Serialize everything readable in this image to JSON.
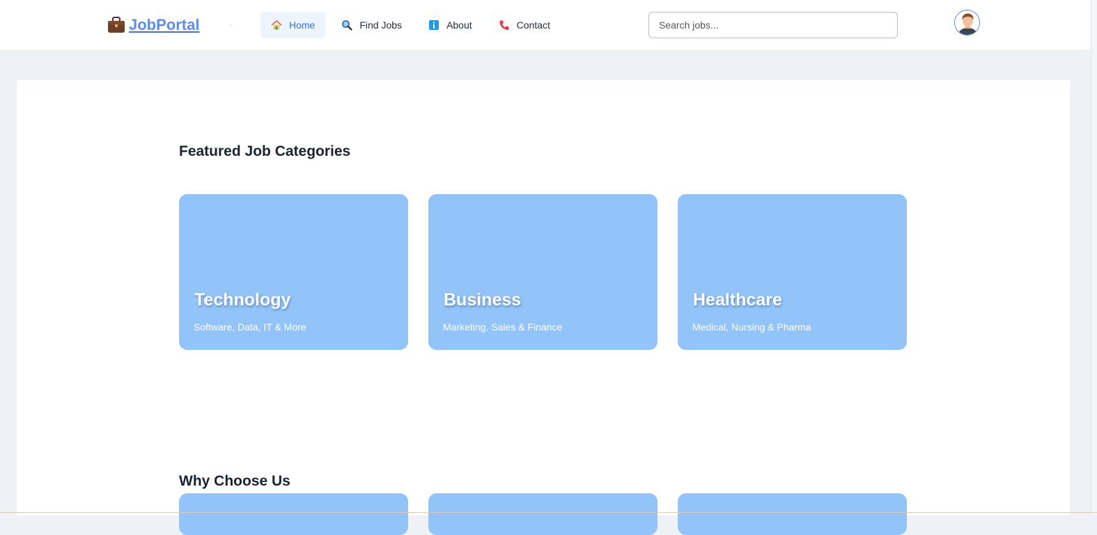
{
  "header": {
    "logo_text": "JobPortal",
    "logo_icon": "briefcase-icon",
    "nav": [
      {
        "label": "Home",
        "icon": "home-icon",
        "active": true
      },
      {
        "label": "Find Jobs",
        "icon": "magnifier-icon",
        "active": false
      },
      {
        "label": "About",
        "icon": "info-icon",
        "active": false
      },
      {
        "label": "Contact",
        "icon": "phone-icon",
        "active": false
      }
    ],
    "search": {
      "placeholder": "Search jobs...",
      "value": ""
    },
    "avatar_icon": "user-avatar-icon"
  },
  "featured": {
    "title": "Featured Job Categories",
    "cards": [
      {
        "title": "Technology",
        "subtitle": "Software, Data, IT & More"
      },
      {
        "title": "Business",
        "subtitle": "Marketing, Sales & Finance"
      },
      {
        "title": "Healthcare",
        "subtitle": "Medical, Nursing & Pharma"
      }
    ]
  },
  "why": {
    "title": "Why Choose Us"
  },
  "colors": {
    "accent": "#3b6fd0",
    "card": "#92c3f9",
    "page_bg": "#eef2f7"
  }
}
